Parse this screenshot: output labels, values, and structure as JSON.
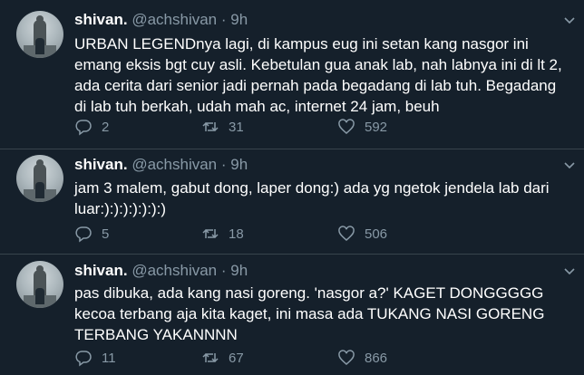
{
  "tweets": [
    {
      "name": "shivan.",
      "handle": "@achshivan",
      "separator": "·",
      "time": "9h",
      "text": "URBAN LEGENDnya lagi, di kampus eug ini setan kang nasgor ini emang eksis bgt cuy asli. Kebetulan gua anak lab, nah labnya ini di lt 2, ada cerita dari senior jadi pernah pada begadang di lab tuh. Begadang di lab tuh berkah, udah mah ac, internet 24 jam, beuh",
      "replies": "2",
      "retweets": "31",
      "likes": "592"
    },
    {
      "name": "shivan.",
      "handle": "@achshivan",
      "separator": "·",
      "time": "9h",
      "text": "jam 3 malem, gabut dong, laper dong:) ada yg ngetok jendela lab dari luar:):):):):):):)",
      "replies": "5",
      "retweets": "18",
      "likes": "506"
    },
    {
      "name": "shivan.",
      "handle": "@achshivan",
      "separator": "·",
      "time": "9h",
      "text": "pas dibuka, ada kang nasi goreng. 'nasgor a?' KAGET DONGGGGG kecoa terbang aja kita kaget, ini masa ada TUKANG NASI GORENG TERBANG YAKANNNN",
      "replies": "11",
      "retweets": "67",
      "likes": "866"
    }
  ],
  "icons": {
    "reply": "reply-icon",
    "retweet": "retweet-icon",
    "like": "heart-icon",
    "menu": "chevron-down-icon"
  },
  "colors": {
    "background": "#15202b",
    "secondary_text": "#8899a6",
    "divider": "#38444d"
  }
}
